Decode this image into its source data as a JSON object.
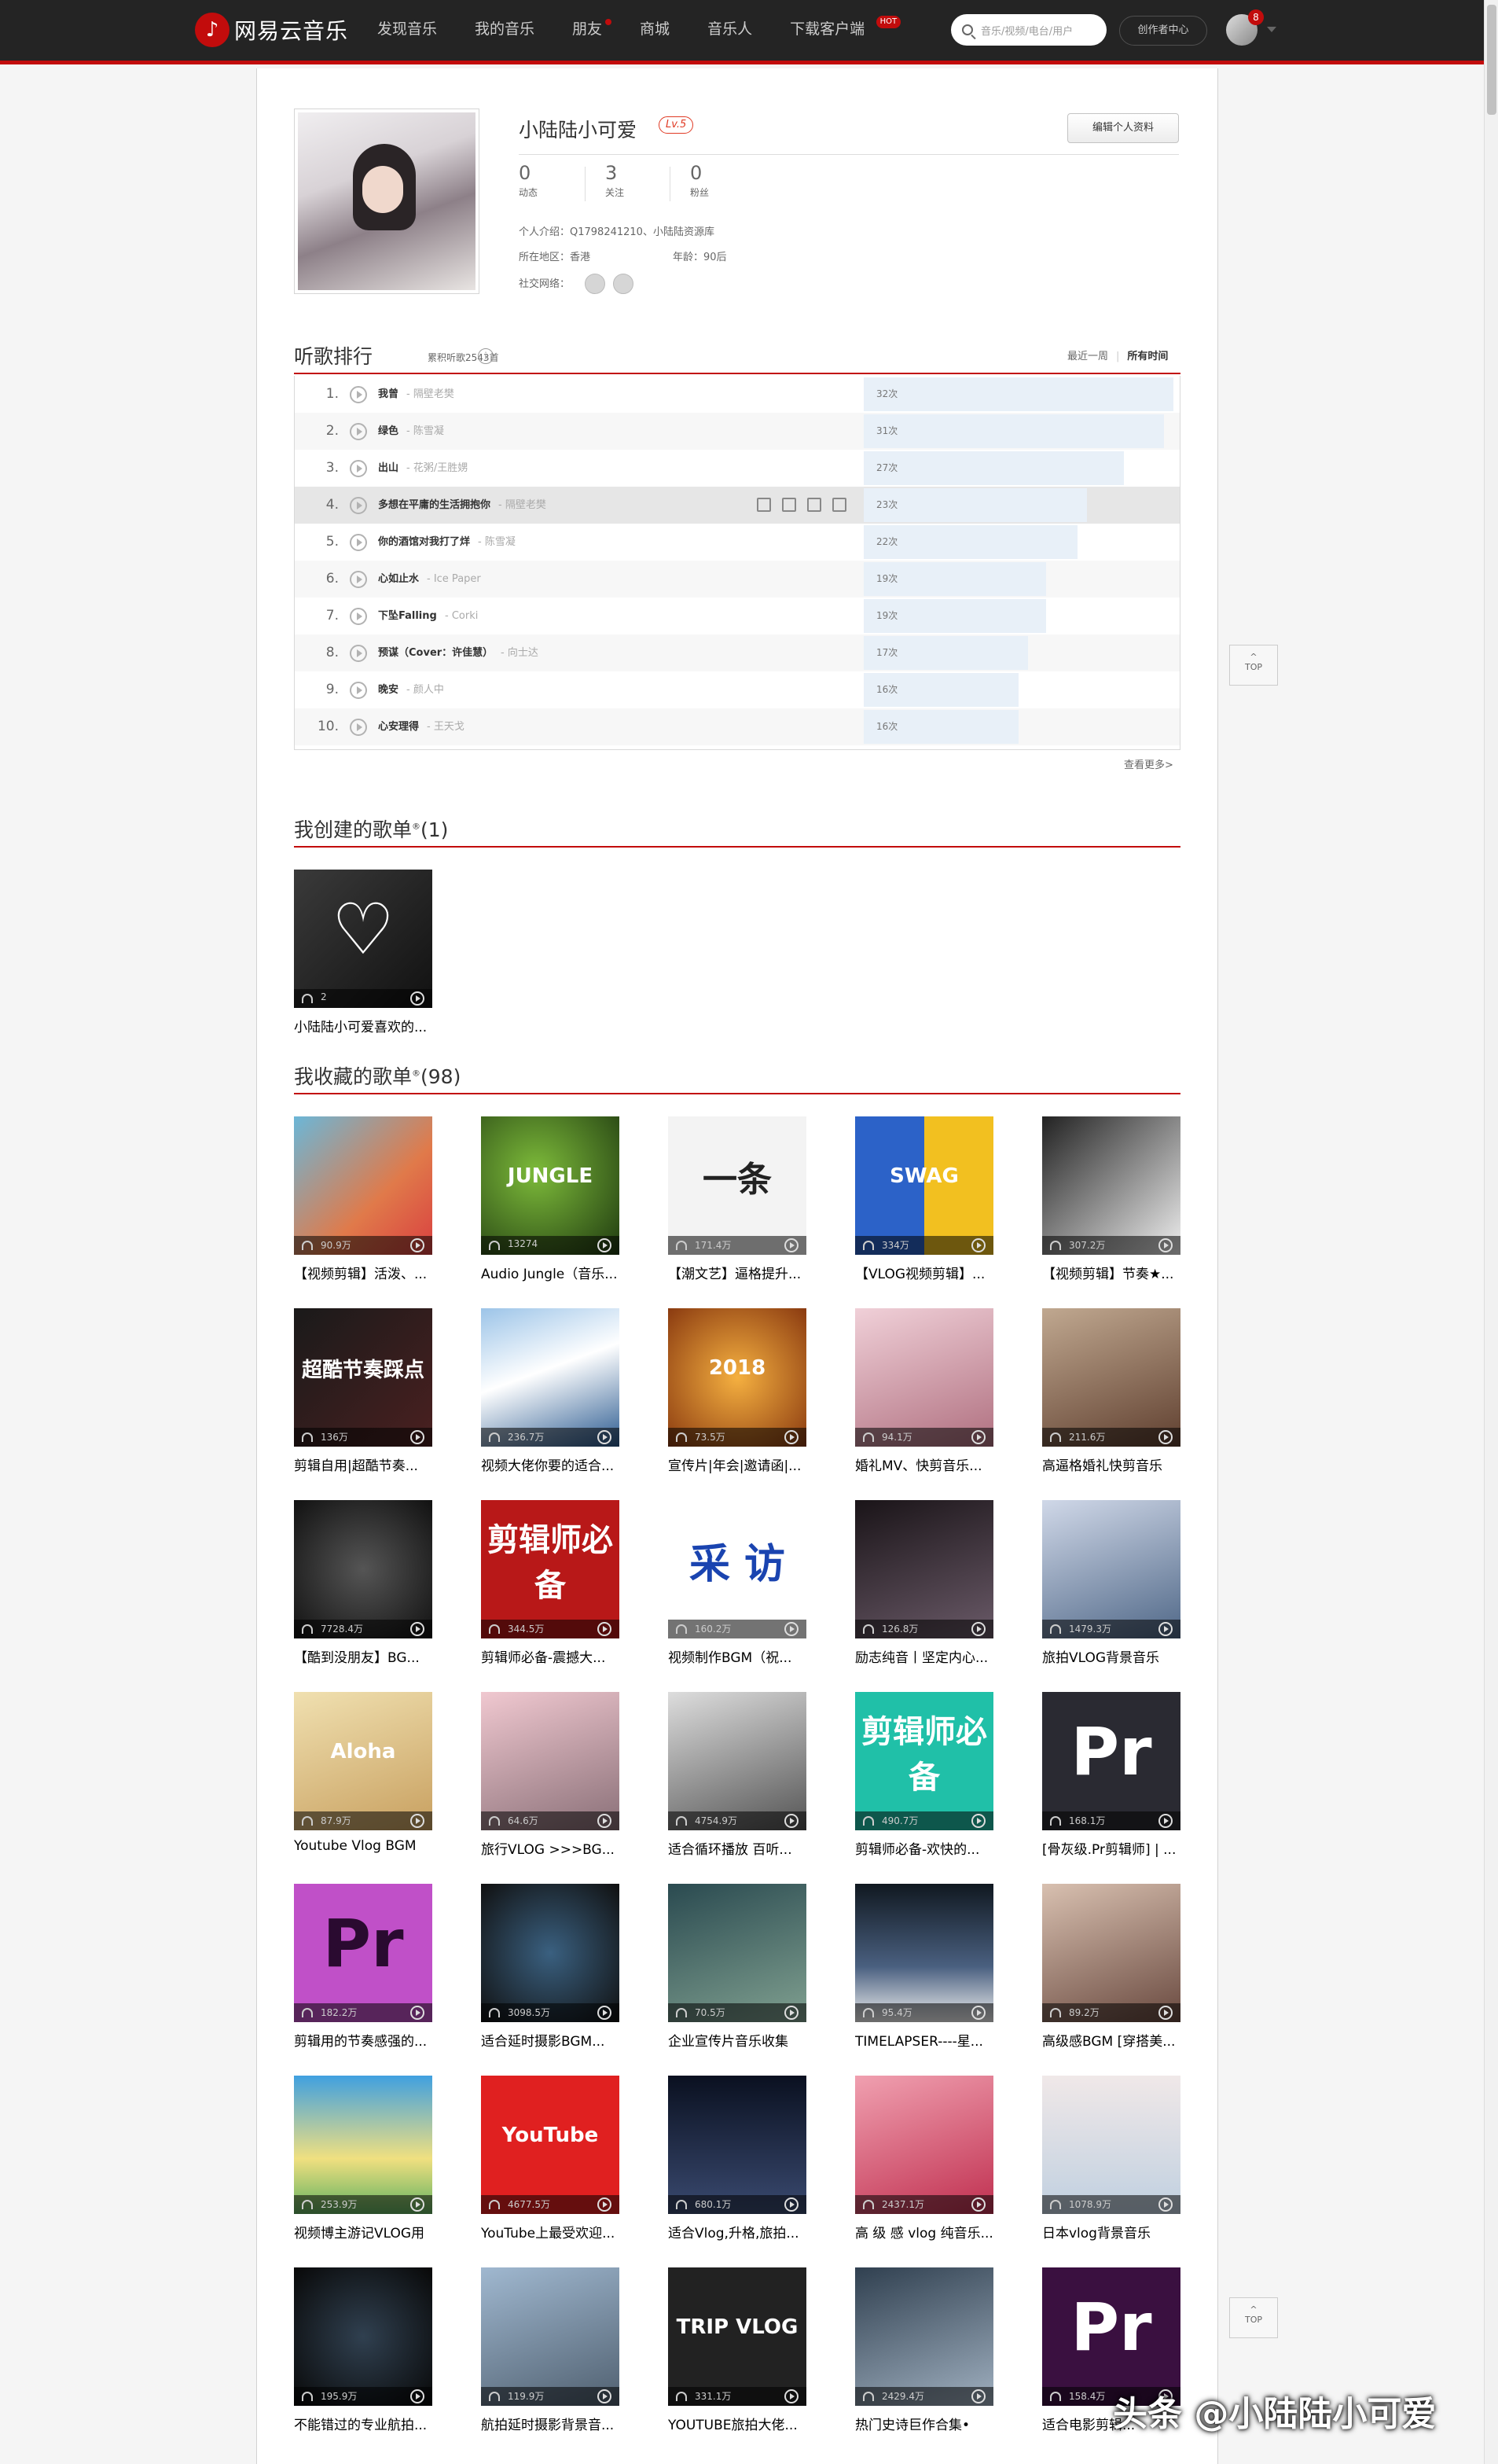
{
  "topbar": {
    "logo_text": "网易云音乐",
    "nav": [
      {
        "label": "发现音乐"
      },
      {
        "label": "我的音乐"
      },
      {
        "label": "朋友"
      },
      {
        "label": "商城"
      },
      {
        "label": "音乐人"
      },
      {
        "label": "下载客户端",
        "badge": "HOT"
      }
    ],
    "search_placeholder": "音乐/视频/电台/用户",
    "creator_label": "创作者中心",
    "msg_count": "8"
  },
  "profile": {
    "name": "小陆陆小可爱",
    "level": "Lv.5",
    "edit_label": "编辑个人资料",
    "stats": [
      {
        "num": "0",
        "label": "动态"
      },
      {
        "num": "3",
        "label": "关注"
      },
      {
        "num": "0",
        "label": "粉丝"
      }
    ],
    "intro": "个人介绍：Q1798241210、小陆陆资源库",
    "region": "所在地区：香港",
    "age": "年龄：90后",
    "social_label": "社交网络："
  },
  "ranking": {
    "title": "听歌排行",
    "subtitle": "累积听歌2543首",
    "tab_week": "最近一周",
    "tab_all": "所有时间",
    "more": "查看更多>",
    "rows": [
      {
        "num": "1.",
        "song": "我曾",
        "artist": "隔壁老樊",
        "count": "32次",
        "frac": 1.0
      },
      {
        "num": "2.",
        "song": "绿色",
        "artist": "陈雪凝",
        "count": "31次",
        "frac": 0.97
      },
      {
        "num": "3.",
        "song": "出山",
        "artist": "花粥/王胜娚",
        "count": "27次",
        "frac": 0.84
      },
      {
        "num": "4.",
        "song": "多想在平庸的生活拥抱你",
        "artist": "隔壁老樊",
        "count": "23次",
        "frac": 0.72
      },
      {
        "num": "5.",
        "song": "你的酒馆对我打了烊",
        "artist": "陈雪凝",
        "count": "22次",
        "frac": 0.69
      },
      {
        "num": "6.",
        "song": "心如止水",
        "artist": "Ice Paper",
        "count": "19次",
        "frac": 0.59
      },
      {
        "num": "7.",
        "song": "下坠Falling",
        "artist": "Corki",
        "count": "19次",
        "frac": 0.59
      },
      {
        "num": "8.",
        "song": "预谋（Cover：许佳慧）",
        "artist": "向士达",
        "count": "17次",
        "frac": 0.53
      },
      {
        "num": "9.",
        "song": "晚安",
        "artist": "颜人中",
        "count": "16次",
        "frac": 0.5
      },
      {
        "num": "10.",
        "song": "心安理得",
        "artist": "王天戈",
        "count": "16次",
        "frac": 0.5
      }
    ]
  },
  "created": {
    "title": "我创建的歌单",
    "count": "(1)",
    "items": [
      {
        "title": "小陆陆小可爱喜欢的...",
        "plays": "2"
      }
    ]
  },
  "collected": {
    "title": "我收藏的歌单",
    "count": "(98)",
    "items": [
      {
        "title": "【视频剪辑】活泼、...",
        "plays": "90.9万",
        "bg": "linear-gradient(135deg,#6bb7d8,#e07a4a 60%,#d94040)",
        "txt": ""
      },
      {
        "title": "Audio Jungle（音乐...",
        "plays": "13274",
        "bg": "radial-gradient(circle at 40% 40%,#7dbb3a,#1f3a10)",
        "txt": "JUNGLE"
      },
      {
        "title": "【潮文艺】逼格提升...",
        "plays": "171.4万",
        "bg": "#f3f3f3",
        "txt": "一条"
      },
      {
        "title": "【VLOG视频剪辑】...",
        "plays": "334万",
        "bg": "linear-gradient(90deg,#2c62c8 50%,#f2c020 50%)",
        "txt": "SWAG"
      },
      {
        "title": "【视频剪辑】节奏★...",
        "plays": "307.2万",
        "bg": "linear-gradient(135deg,#222,#888 50%,#eee)",
        "txt": ""
      },
      {
        "title": "剪辑自用|超酷节奏...",
        "plays": "136万",
        "bg": "linear-gradient(135deg,#1a1a1a,#4a2020)",
        "txt": "超酷节奏踩点"
      },
      {
        "title": "视频大佬你要的适合...",
        "plays": "236.7万",
        "bg": "linear-gradient(160deg,#9cc4e8,#ffffff 45%,#2a5a90)",
        "txt": ""
      },
      {
        "title": "宣传片|年会|邀请函|...",
        "plays": "73.5万",
        "bg": "radial-gradient(circle,#f5b040,#8a3a10)",
        "txt": "2018"
      },
      {
        "title": "婚礼MV、快剪音乐...",
        "plays": "94.1万",
        "bg": "linear-gradient(160deg,#f0d0d8,#b07080)",
        "txt": ""
      },
      {
        "title": "高逼格婚礼快剪音乐",
        "plays": "211.6万",
        "bg": "linear-gradient(160deg,#c0a890,#604030)",
        "txt": ""
      },
      {
        "title": "【酷到没朋友】BG...",
        "plays": "7728.4万",
        "bg": "radial-gradient(circle,#555,#111)",
        "txt": ""
      },
      {
        "title": "剪辑师必备-震撼大...",
        "plays": "344.5万",
        "bg": "#b81818",
        "txt": "剪辑师必备"
      },
      {
        "title": "视频制作BGM（祝...",
        "plays": "160.2万",
        "bg": "#ffffff",
        "txt": "采 访"
      },
      {
        "title": "励志纯音丨坚定内心...",
        "plays": "126.8万",
        "bg": "linear-gradient(160deg,#1a1418,#6a5a68)",
        "txt": ""
      },
      {
        "title": "旅拍VLOG背景音乐",
        "plays": "1479.3万",
        "bg": "linear-gradient(160deg,#d0d8e8,#506888)",
        "txt": ""
      },
      {
        "title": "Youtube Vlog BGM",
        "plays": "87.9万",
        "bg": "linear-gradient(160deg,#f0e0b0,#c8a060)",
        "txt": "Aloha"
      },
      {
        "title": "旅行VLOG >>>BG...",
        "plays": "64.6万",
        "bg": "linear-gradient(160deg,#f0c8d0,#8a7078)",
        "txt": ""
      },
      {
        "title": "适合循环播放 百听...",
        "plays": "4754.9万",
        "bg": "linear-gradient(160deg,#ddd,#555)",
        "txt": ""
      },
      {
        "title": "剪辑师必备-欢快的...",
        "plays": "490.7万",
        "bg": "#20c0a8",
        "txt": "剪辑师必备"
      },
      {
        "title": "[骨灰级.Pr剪辑师] | ...",
        "plays": "168.1万",
        "bg": "#2a2a32",
        "txt": "Pr"
      },
      {
        "title": "剪辑用的节奏感强的...",
        "plays": "182.2万",
        "bg": "#c050c8",
        "txt": "Pr"
      },
      {
        "title": "适合延时摄影BGM...",
        "plays": "3098.5万",
        "bg": "radial-gradient(circle,#3a6080,#101010)",
        "txt": ""
      },
      {
        "title": "企业宣传片音乐收集",
        "plays": "70.5万",
        "bg": "linear-gradient(160deg,#2a4a50,#80a090)",
        "txt": ""
      },
      {
        "title": "TIMELAPSER----星...",
        "plays": "95.4万",
        "bg": "linear-gradient(180deg,#101820,#4a6080 60%,#f0f0f0)",
        "txt": ""
      },
      {
        "title": "高级感BGM [穿搭美...",
        "plays": "89.2万",
        "bg": "linear-gradient(160deg,#d8c0b0,#6a4a40)",
        "txt": ""
      },
      {
        "title": "视频博主游记VLOG用",
        "plays": "253.9万",
        "bg": "linear-gradient(180deg,#40a0e0,#f0e080 60%,#60b060)",
        "txt": ""
      },
      {
        "title": "YouTube上最受欢迎...",
        "plays": "4677.5万",
        "bg": "#e02020",
        "txt": "YouTube"
      },
      {
        "title": "适合Vlog,升格,旅拍...",
        "plays": "680.1万",
        "bg": "linear-gradient(180deg,#0a1020,#3a4a70)",
        "txt": ""
      },
      {
        "title": "高 级 感 vlog 纯音乐...",
        "plays": "2437.1万",
        "bg": "linear-gradient(160deg,#f0a0b0,#c03050)",
        "txt": ""
      },
      {
        "title": "日本vlog背景音乐",
        "plays": "1078.9万",
        "bg": "linear-gradient(180deg,#f0e8e8,#c0d0e0)",
        "txt": ""
      },
      {
        "title": "不能错过的专业航拍...",
        "plays": "195.9万",
        "bg": "radial-gradient(circle,#304050,#080808)",
        "txt": ""
      },
      {
        "title": "航拍延时摄影背景音...",
        "plays": "119.9万",
        "bg": "linear-gradient(160deg,#a0b8d0,#506070)",
        "txt": ""
      },
      {
        "title": "YOUTUBE旅拍大佬...",
        "plays": "331.1万",
        "bg": "#222222",
        "txt": "TRIP VLOG"
      },
      {
        "title": "热门史诗巨作合集•",
        "plays": "2429.4万",
        "bg": "linear-gradient(160deg,#304050,#a0b0c0)",
        "txt": ""
      },
      {
        "title": "适合电影剪辑...",
        "plays": "158.4万",
        "bg": "#3a1040",
        "txt": "Pr"
      }
    ]
  },
  "totop_label": "TOP",
  "watermark": "头条 @小陆陆小可爱"
}
